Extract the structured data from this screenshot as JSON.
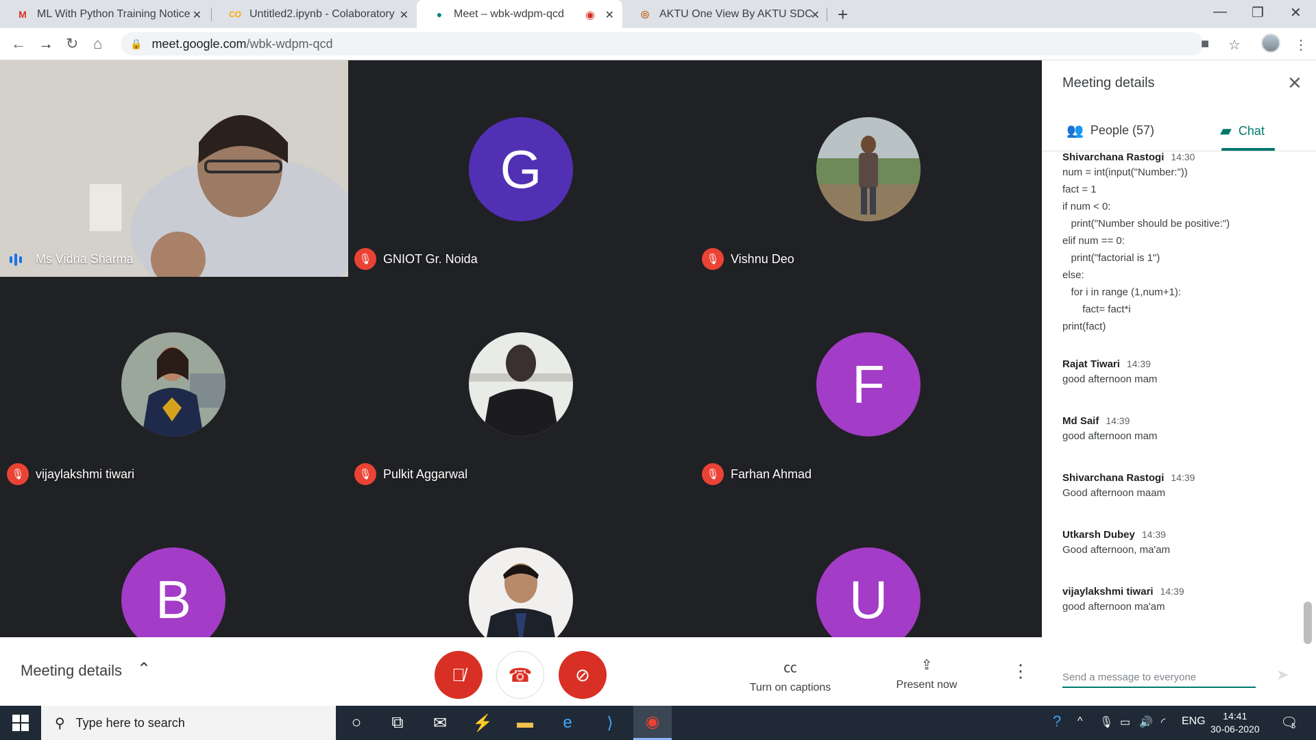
{
  "browser": {
    "tabs": [
      {
        "title": "ML With Python Training Notice",
        "icon": "gmail-icon"
      },
      {
        "title": "Untitled2.ipynb - Colaboratory",
        "icon": "colab-icon"
      },
      {
        "title": "Meet – wbk-wdpm-qcd",
        "icon": "meet-icon"
      },
      {
        "title": "AKTU One View By AKTU SDC",
        "icon": "aktu-icon"
      }
    ],
    "url_host": "meet.google.com",
    "url_path": "/wbk-wdpm-qcd"
  },
  "participants": [
    {
      "name": "Ms Vidha Sharma",
      "kind": "video"
    },
    {
      "name": "GNIOT Gr. Noida",
      "kind": "letter",
      "letter": "G",
      "color": "#5230b4"
    },
    {
      "name": "Vishnu Deo",
      "kind": "photo"
    },
    {
      "name": "vijaylakshmi tiwari",
      "kind": "photo"
    },
    {
      "name": "Pulkit Aggarwal",
      "kind": "photo"
    },
    {
      "name": "Farhan Ahmad",
      "kind": "letter",
      "letter": "F",
      "color": "#a33cc7"
    },
    {
      "name": "",
      "kind": "letter",
      "letter": "B",
      "color": "#a33cc7"
    },
    {
      "name": "",
      "kind": "photo"
    },
    {
      "name": "",
      "kind": "letter",
      "letter": "U",
      "color": "#a33cc7"
    }
  ],
  "controls": {
    "meeting_details": "Meeting details",
    "captions": "Turn on captions",
    "present": "Present now"
  },
  "panel": {
    "title": "Meeting details",
    "people_tab": "People (57)",
    "chat_tab": "Chat",
    "input_placeholder": "Send a message to everyone",
    "messages": [
      {
        "sender": "Shivarchana Rastogi",
        "time": "14:30",
        "lines": [
          "num = int(input(\"Number:\"))",
          "fact = 1",
          "if num < 0:",
          "   print(\"Number should be positive:\")",
          "elif num == 0:",
          "   print(\"factorial is 1\")",
          "else:",
          "   for i in range (1,num+1):",
          "       fact= fact*i",
          "print(fact)"
        ]
      },
      {
        "sender": "Rajat Tiwari",
        "time": "14:39",
        "lines": [
          "good afternoon mam"
        ]
      },
      {
        "sender": "Md Saif",
        "time": "14:39",
        "lines": [
          "good afternoon mam"
        ]
      },
      {
        "sender": "Shivarchana Rastogi",
        "time": "14:39",
        "lines": [
          "Good afternoon maam"
        ]
      },
      {
        "sender": "Utkarsh Dubey",
        "time": "14:39",
        "lines": [
          "Good afternoon, ma'am"
        ]
      },
      {
        "sender": "vijaylakshmi tiwari",
        "time": "14:39",
        "lines": [
          "good afternoon ma'am"
        ]
      }
    ]
  },
  "taskbar": {
    "search_placeholder": "Type here to search",
    "lang": "ENG",
    "time": "14:41",
    "date": "30-06-2020",
    "notifications": "5"
  }
}
